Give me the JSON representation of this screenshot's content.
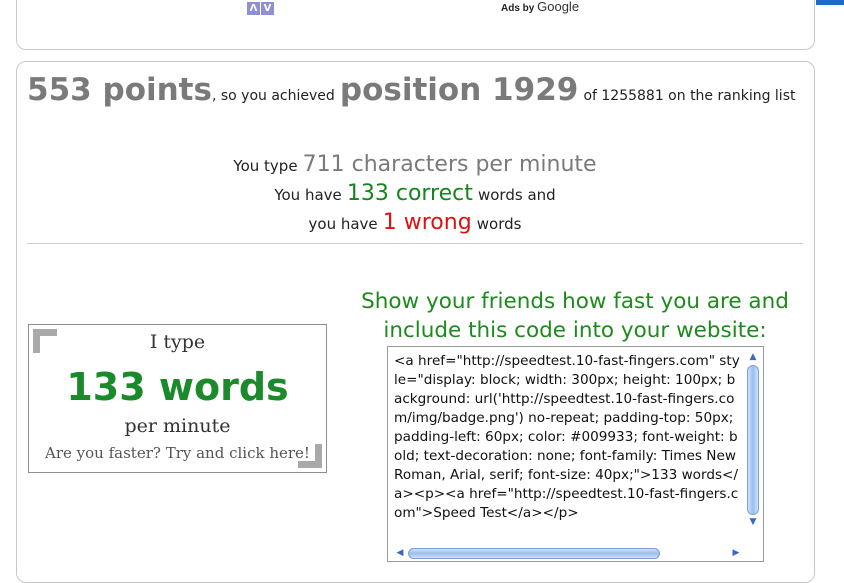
{
  "ads": {
    "arrows": [
      "Λ",
      "V"
    ],
    "ads_by_label": "Ads by ",
    "google_label": "Google"
  },
  "ranking": {
    "points": "553 points",
    "mid_text": ", so you achieved",
    "position": "position 1929",
    "of_text": "of 1255881 on the ranking list"
  },
  "stats": {
    "cpm_prefix": "You type",
    "cpm_value": "711 characters per minute",
    "correct_prefix": "You have",
    "correct_value": "133 correct",
    "correct_suffix": "words and",
    "wrong_prefix": "you have",
    "wrong_value": "1 wrong",
    "wrong_suffix": "words"
  },
  "share": {
    "heading_line1": "Show your friends how fast you are and",
    "heading_line2": "include this code into your website:"
  },
  "badge": {
    "i_type": "I type",
    "words": "133 words",
    "per_minute": "per minute",
    "cta": "Are you faster? Try and click here!"
  },
  "embed_code": {
    "text": "<a href=\"http://speedtest.10-fast-fingers.com\" style=\"display: block; width: 300px; height: 100px; background: url('http://speedtest.10-fast-fingers.com/img/badge.png') no-repeat; padding-top: 50px; padding-left: 60px; color: #009933; font-weight: bold; text-decoration: none; font-family: Times New Roman, Arial, serif; font-size: 40px;\">133 words</a><p><a href=\"http://speedtest.10-fast-fingers.com\">Speed Test</a></p>"
  },
  "colors": {
    "accent_green": "#1a8a2a",
    "wrong_red": "#dd1111",
    "muted_gray": "#7a7a7a"
  }
}
